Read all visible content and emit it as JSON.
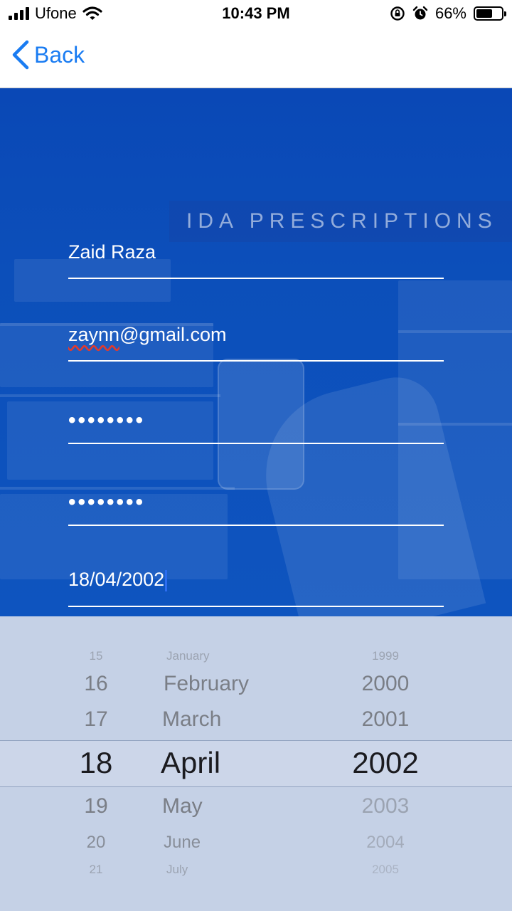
{
  "status_bar": {
    "carrier": "Ufone",
    "time": "10:43 PM",
    "battery_percent": "66%",
    "battery_level": 0.66,
    "icons": [
      "signal-icon",
      "wifi-icon",
      "rotation-lock-icon",
      "alarm-icon",
      "battery-icon"
    ]
  },
  "nav": {
    "back_label": "Back"
  },
  "form": {
    "name": "Zaid Raza",
    "email_misspelled": "zaynn",
    "email_rest": "@gmail.com",
    "password": "••••••••",
    "confirm_password": "••••••••",
    "dob": "18/04/2002"
  },
  "background": {
    "banner_text": "IDA PRESCRIPTIONS"
  },
  "picker": {
    "days": [
      "15",
      "16",
      "17",
      "18",
      "19",
      "20",
      "21"
    ],
    "months": [
      "January",
      "February",
      "March",
      "April",
      "May",
      "June",
      "July"
    ],
    "years": [
      "1999",
      "2000",
      "2001",
      "2002",
      "2003",
      "2004",
      "2005"
    ],
    "selected": {
      "day": "18",
      "month": "April",
      "year": "2002"
    }
  },
  "colors": {
    "accent": "#1a7cf2",
    "hero_blue": "#0c4fba",
    "picker_bg": "#c5d1e6"
  }
}
